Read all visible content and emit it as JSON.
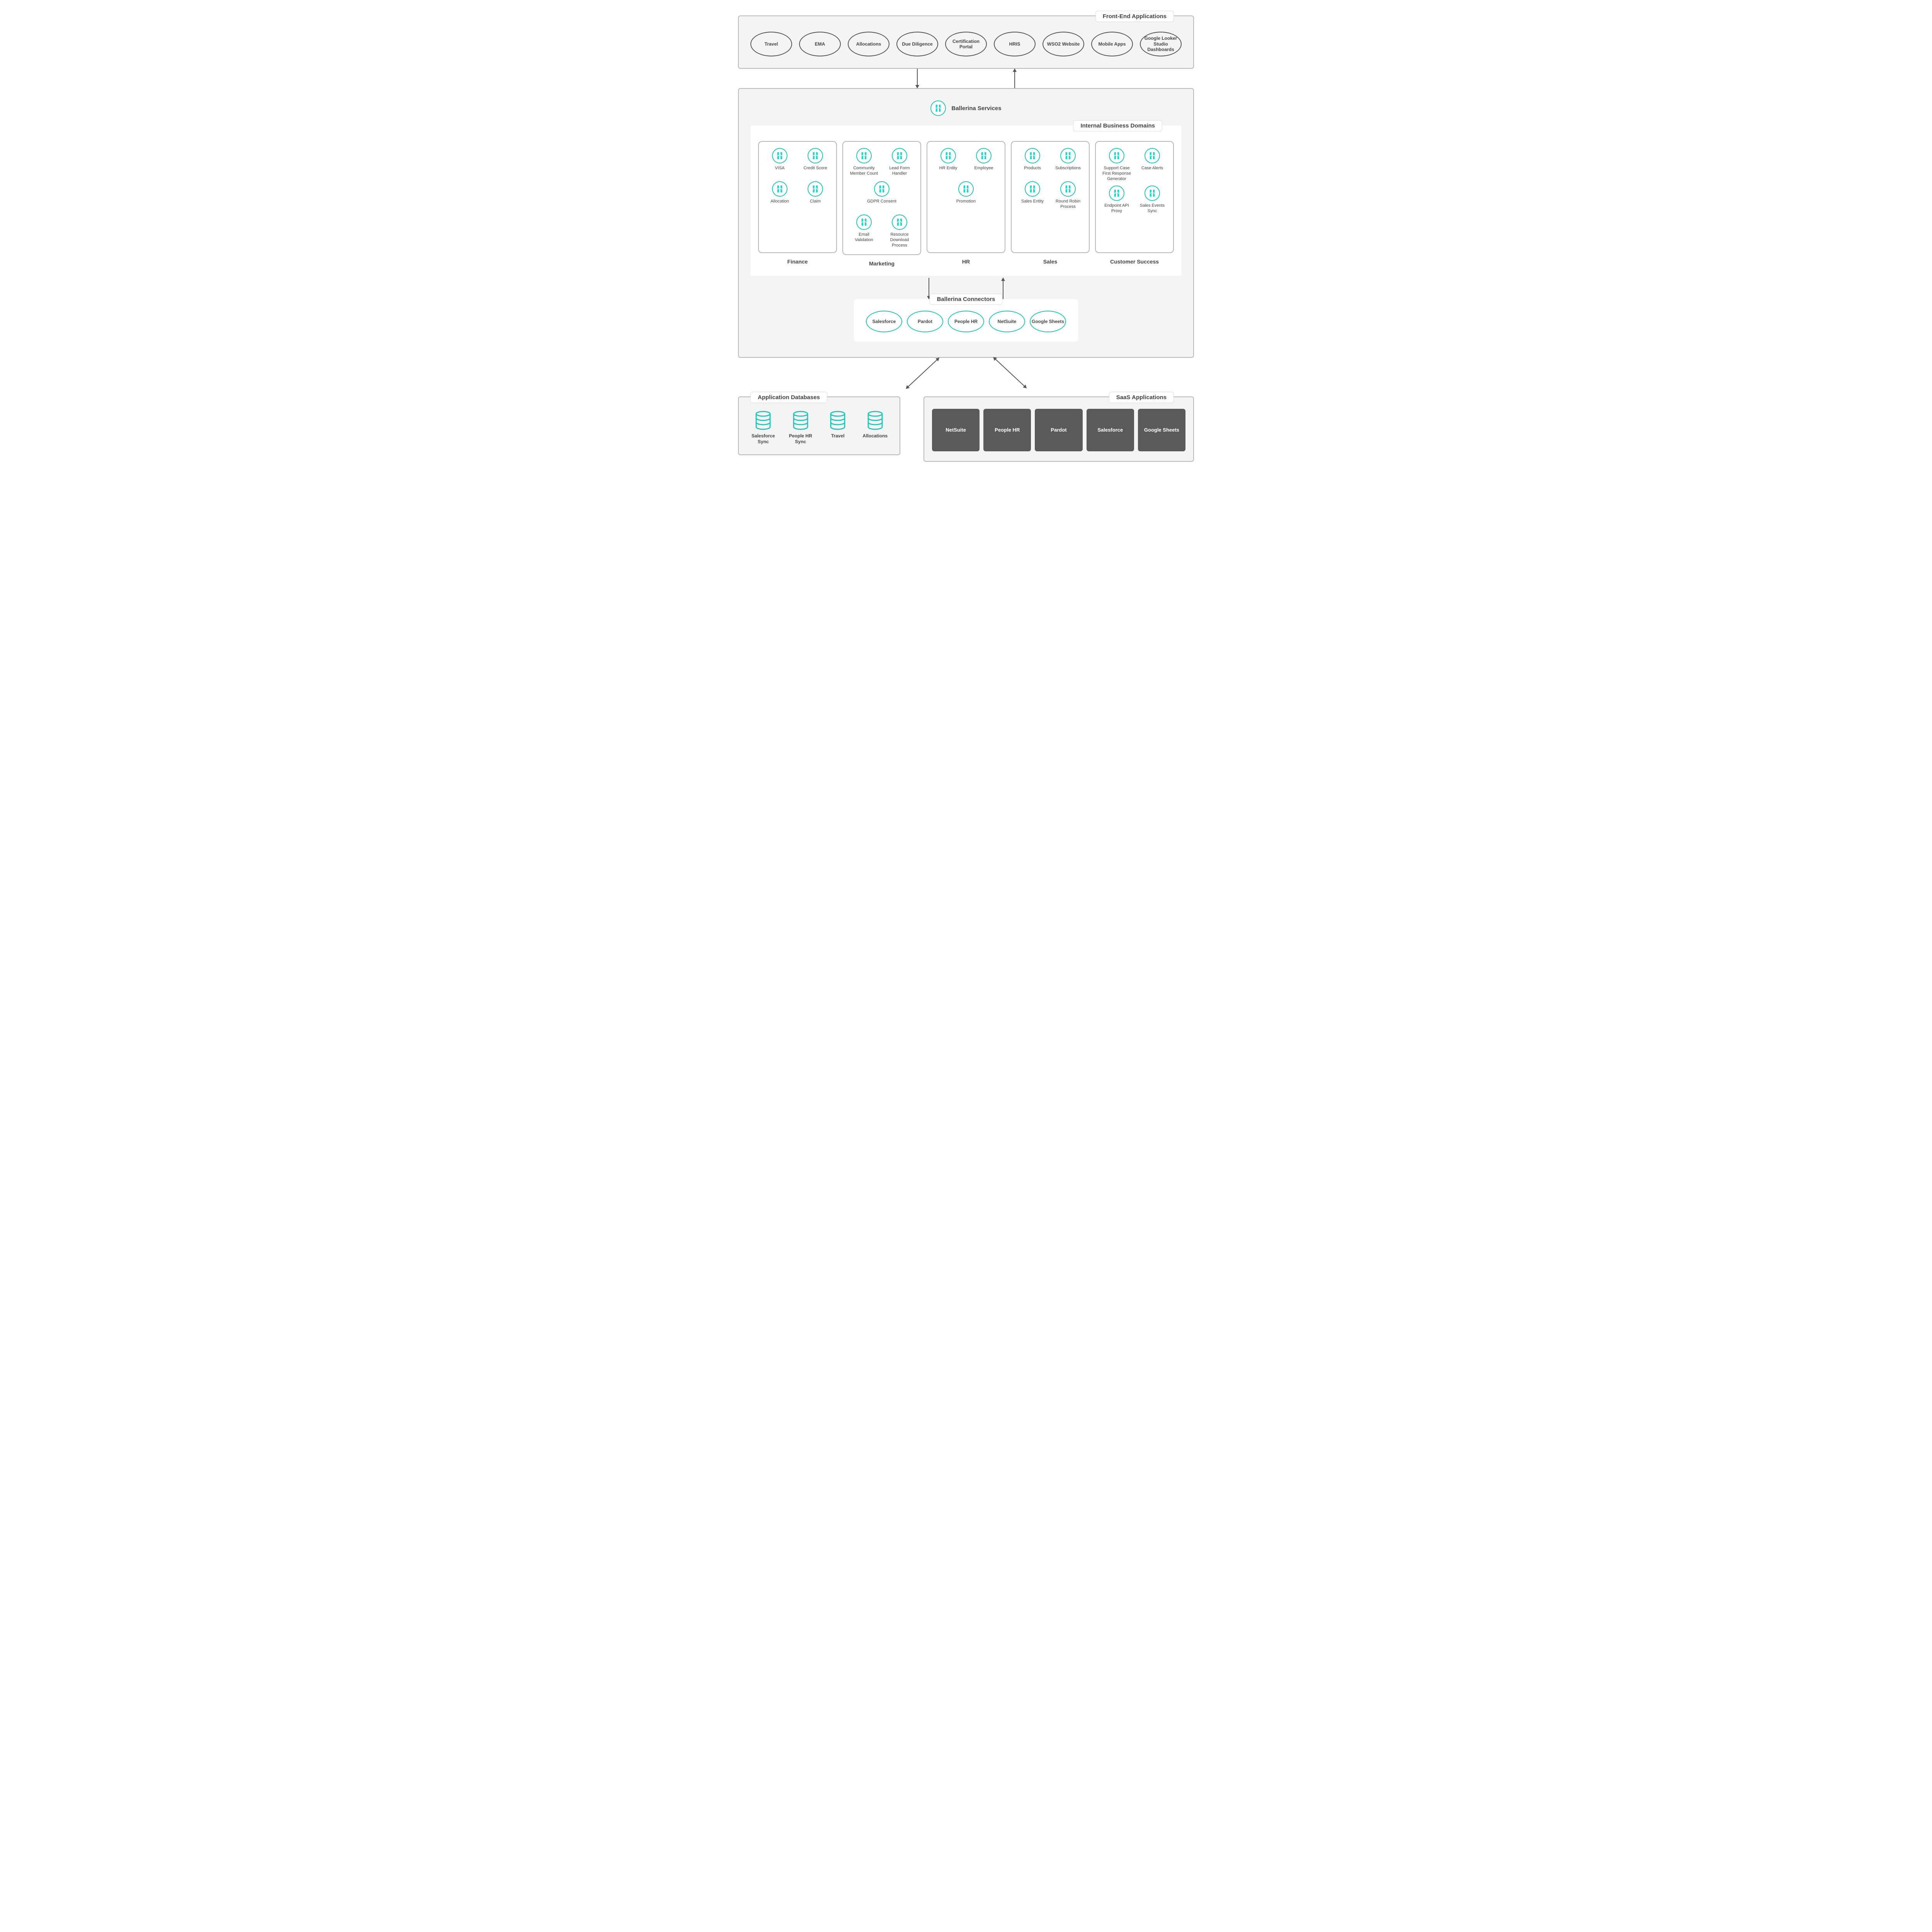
{
  "colors": {
    "teal": "#29d4c6",
    "gray_border": "#b8b8b8",
    "dark_tile": "#5a5a5a"
  },
  "frontEnd": {
    "title": "Front-End Applications",
    "items": [
      "Travel",
      "EMA",
      "Allocations",
      "Due Diligence",
      "Certification Portal",
      "HRIS",
      "WSO2 Website",
      "Mobile Apps",
      "Google Looker Studio Dashboards"
    ]
  },
  "services": {
    "header": "Ballerina Services",
    "domainsTitle": "Internal Business Domains",
    "domains": [
      {
        "name": "Finance",
        "items": [
          "VISA",
          "Credit Score",
          "Allocation",
          "Claim"
        ]
      },
      {
        "name": "Marketing",
        "items": [
          "Community Member Count",
          "Lead Form Handler",
          "GDPR Consent",
          "Email Validation",
          "Resource Download Process"
        ]
      },
      {
        "name": "HR",
        "items": [
          "HR Entity",
          "Employee",
          "Promotion"
        ]
      },
      {
        "name": "Sales",
        "items": [
          "Products",
          "Subscriptions",
          "Sales Entity",
          "Round Robin Process"
        ]
      },
      {
        "name": "Customer Success",
        "items": [
          "Support Case First Response Generator",
          "Case Alerts",
          "Endpoint API Proxy",
          "Sales Events Sync"
        ]
      }
    ]
  },
  "connectors": {
    "title": "Ballerina Connectors",
    "items": [
      "Salesforce",
      "Pardot",
      "People HR",
      "NetSuite",
      "Google Sheets"
    ]
  },
  "appdb": {
    "title": "Application Databases",
    "items": [
      "Salesforce Sync",
      "People HR Sync",
      "Travel",
      "Allocations"
    ]
  },
  "saas": {
    "title": "SaaS Applications",
    "items": [
      "NetSuite",
      "People HR",
      "Pardot",
      "Salesforce",
      "Google Sheets"
    ]
  }
}
